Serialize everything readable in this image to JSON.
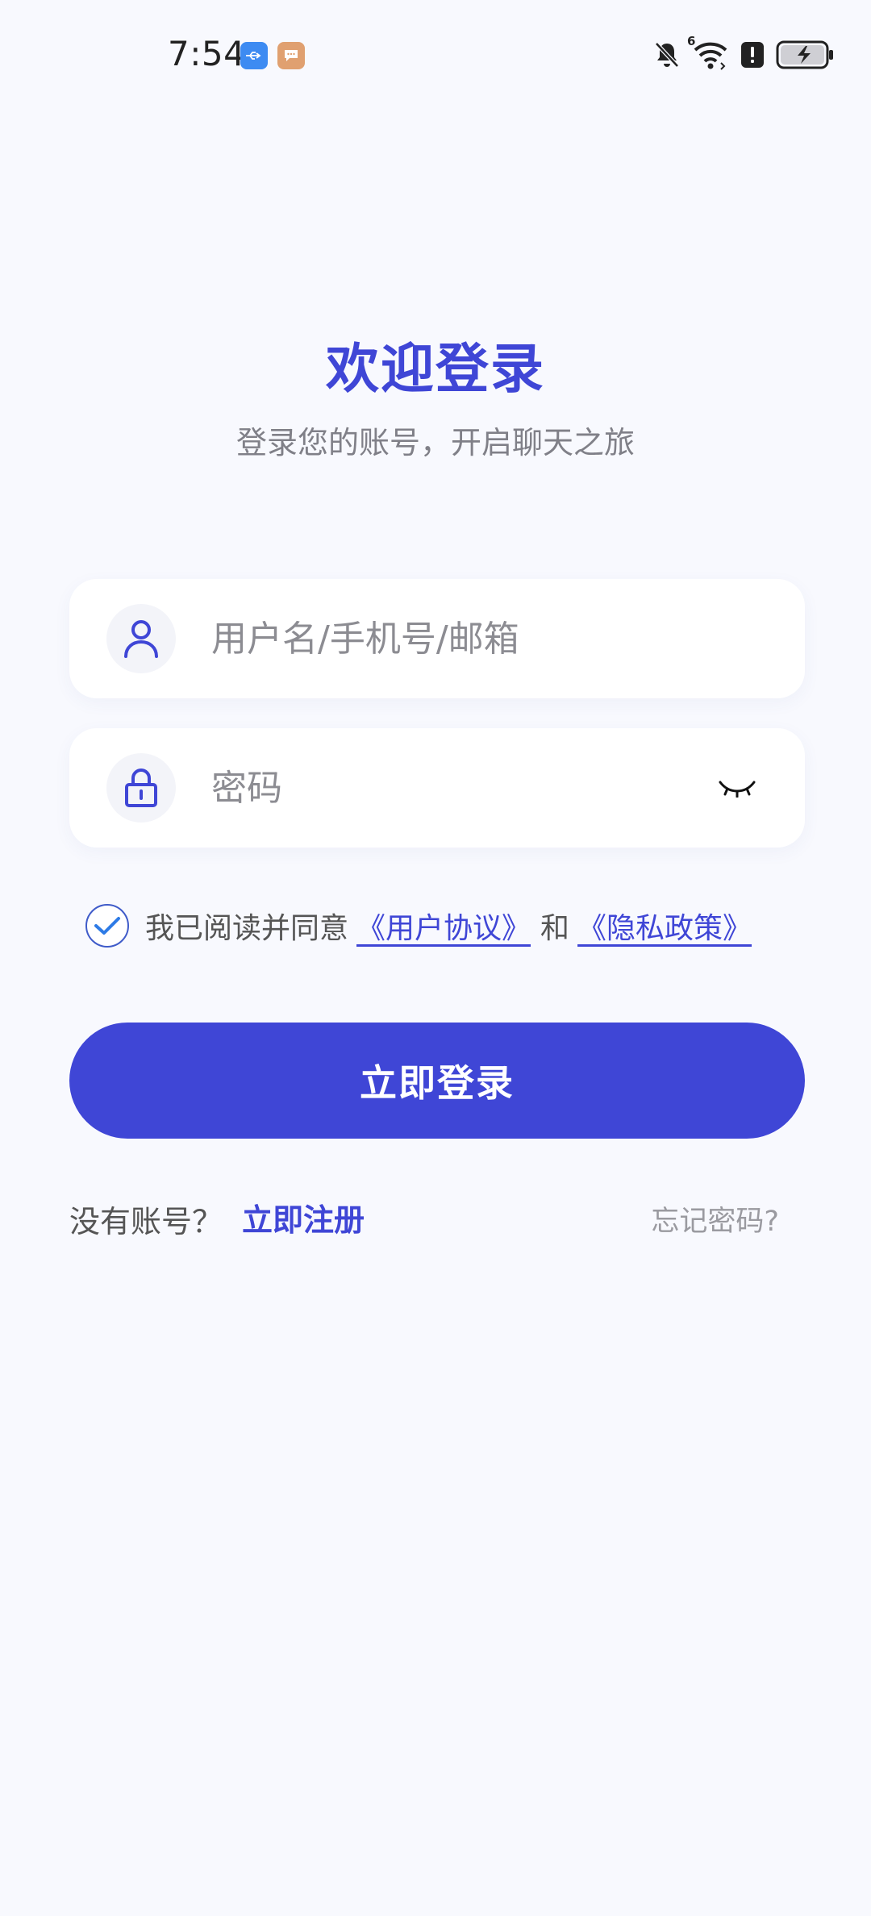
{
  "status_bar": {
    "time": "7:54",
    "icons": [
      "usb-icon",
      "message-icon",
      "bell-muted-icon",
      "wifi-6-icon",
      "alert-icon",
      "battery-charging-icon"
    ],
    "wifi_badge": "6"
  },
  "header": {
    "title": "欢迎登录",
    "subtitle": "登录您的账号，开启聊天之旅"
  },
  "form": {
    "username_placeholder": "用户名/手机号/邮箱",
    "password_placeholder": "密码",
    "password_toggle_icon": "eye-closed-icon"
  },
  "agreement": {
    "checked": true,
    "prefix": "我已阅读并同意",
    "user_agreement": "《用户协议》",
    "and": "和",
    "privacy_policy": "《隐私政策》"
  },
  "actions": {
    "login_label": "立即登录",
    "no_account": "没有账号？",
    "register_label": "立即注册",
    "forgot_label": "忘记密码?"
  },
  "colors": {
    "accent": "#3F46D6",
    "background": "#F8F9FE",
    "muted_text": "#808088"
  }
}
